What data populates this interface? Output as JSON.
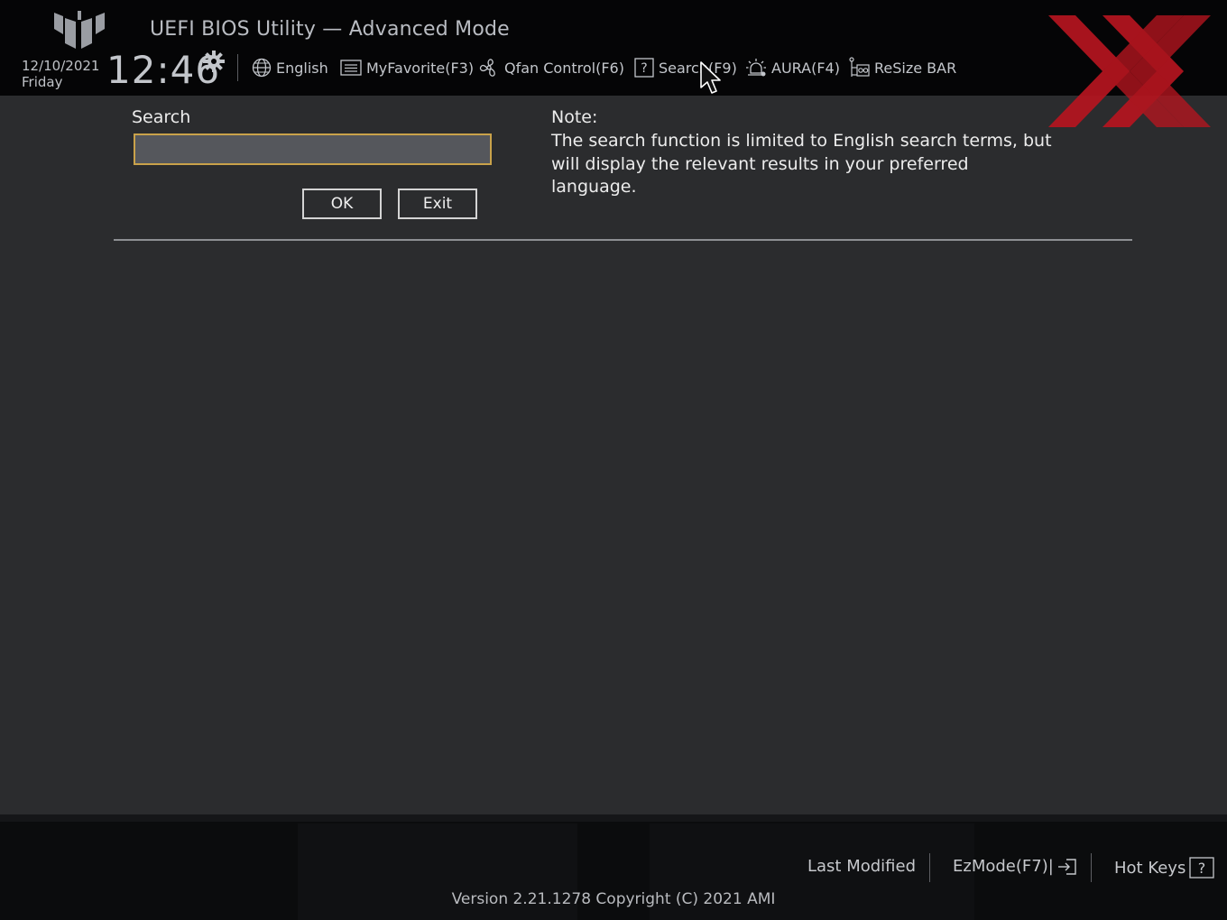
{
  "header": {
    "title": "UEFI BIOS Utility — Advanced Mode",
    "date": "12/10/2021",
    "day": "Friday",
    "time": "12:46",
    "nav": {
      "language": "English",
      "myfavorite": "MyFavorite(F3)",
      "qfan": "Qfan Control(F6)",
      "search": "Search(F9)",
      "aura": "AURA(F4)",
      "resize_bar": "ReSize BAR"
    }
  },
  "search_panel": {
    "label": "Search",
    "input_value": "",
    "ok_label": "OK",
    "exit_label": "Exit"
  },
  "note": {
    "title": "Note:",
    "text": "The search function is limited to English search terms, but will display the relevant results in your preferred language."
  },
  "footer": {
    "last_modified": "Last Modified",
    "ezmode": "EzMode(F7)|",
    "hot_keys": "Hot Keys",
    "version": "Version 2.21.1278 Copyright (C) 2021 AMI"
  },
  "colors": {
    "background": "#2b2c2e",
    "header_bg": "#050506",
    "input_border": "#c9a24a",
    "brand_red": "#b5151f"
  }
}
